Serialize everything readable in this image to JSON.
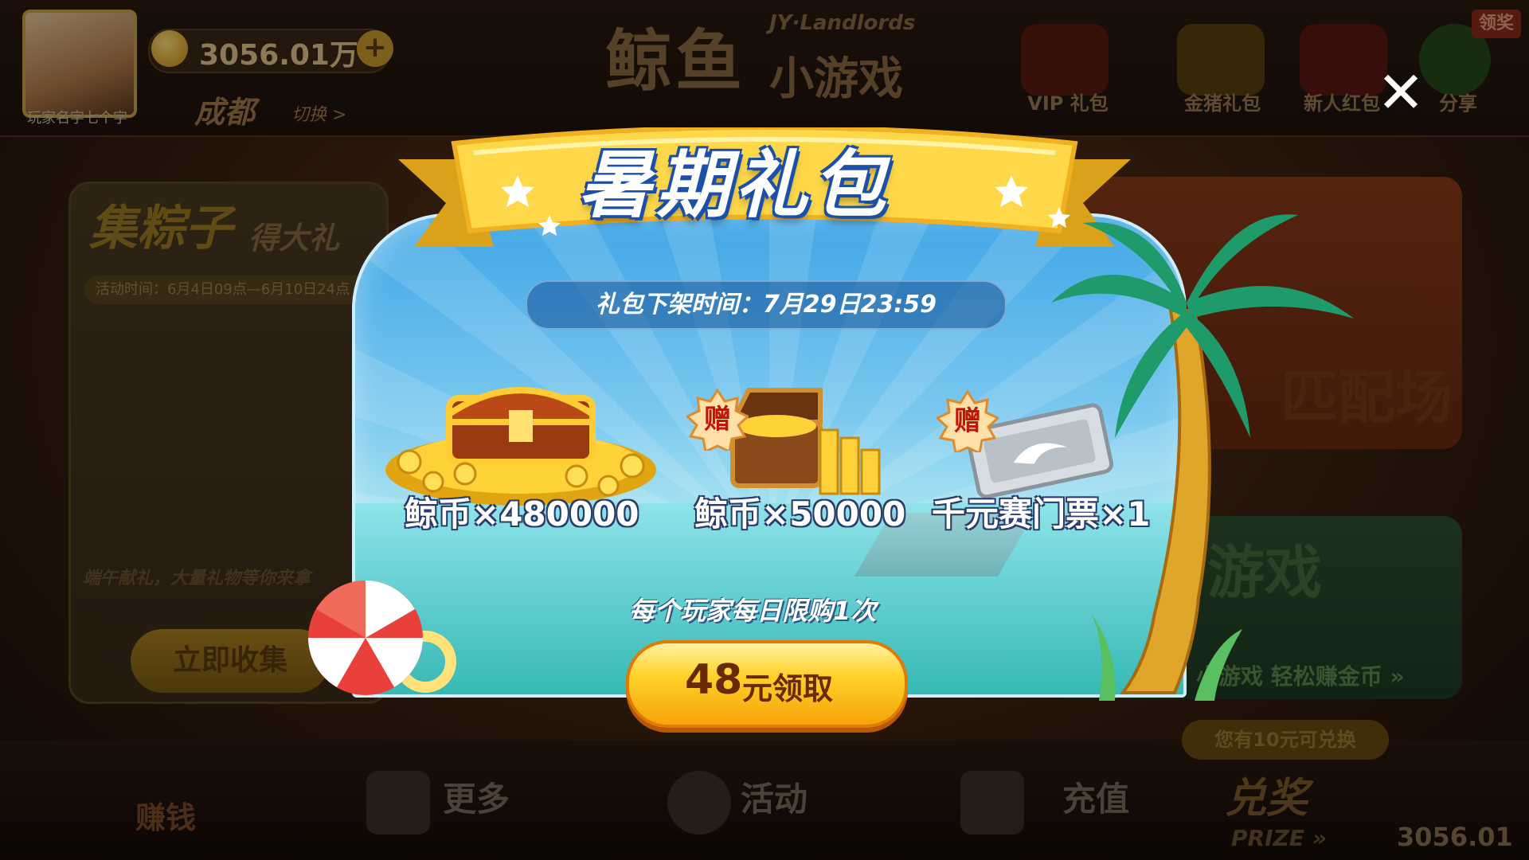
{
  "lobby": {
    "player_name": "玩家名字七个字",
    "coins": "3056.01万",
    "city": "成都",
    "switch_label": "切换 >",
    "logo_main": "鲸鱼",
    "logo_sub": "小游戏",
    "logo_en": "JY·Landlords",
    "top_icons": [
      "VIP 礼包",
      "金猪礼包",
      "新人红包",
      "分享"
    ],
    "claim_badge": "领奖",
    "event_title": "集粽子",
    "event_subtitle": "得大礼",
    "event_time": "活动时间：6月4日09点—6月10日24点",
    "event_desc": "端午献礼，大量礼物等你来拿",
    "collect_button": "立即收集",
    "match_label": "匹配场",
    "mini_game_label": "游戏",
    "mini_game_sub": "小游戏 轻松赚金币 »",
    "bottom_nav": [
      "更多",
      "活动",
      "充值"
    ],
    "earn_label": "赚钱",
    "exchange_pill": "您有10元可兑换",
    "prize_label": "兑奖",
    "prize_en": "PRIZE »",
    "prize_amount": "3056.01"
  },
  "popup": {
    "title": "暑期礼包",
    "time_label": "礼包下架时间：7月29日23:59",
    "items": [
      {
        "label": "鲸币×480000",
        "bonus": false
      },
      {
        "label": "鲸币×50000",
        "bonus": true,
        "tag": "赠"
      },
      {
        "label": "千元赛门票×1",
        "bonus": true,
        "tag": "赠"
      }
    ],
    "limit_text": "每个玩家每日限购1次",
    "buy_price": "48",
    "buy_text": "元领取",
    "close_glyph": "✕"
  },
  "colors": {
    "title_stroke": "#1b4fa8",
    "button_gold": "#ffd12a",
    "sky_blue": "#3fa6e6"
  }
}
